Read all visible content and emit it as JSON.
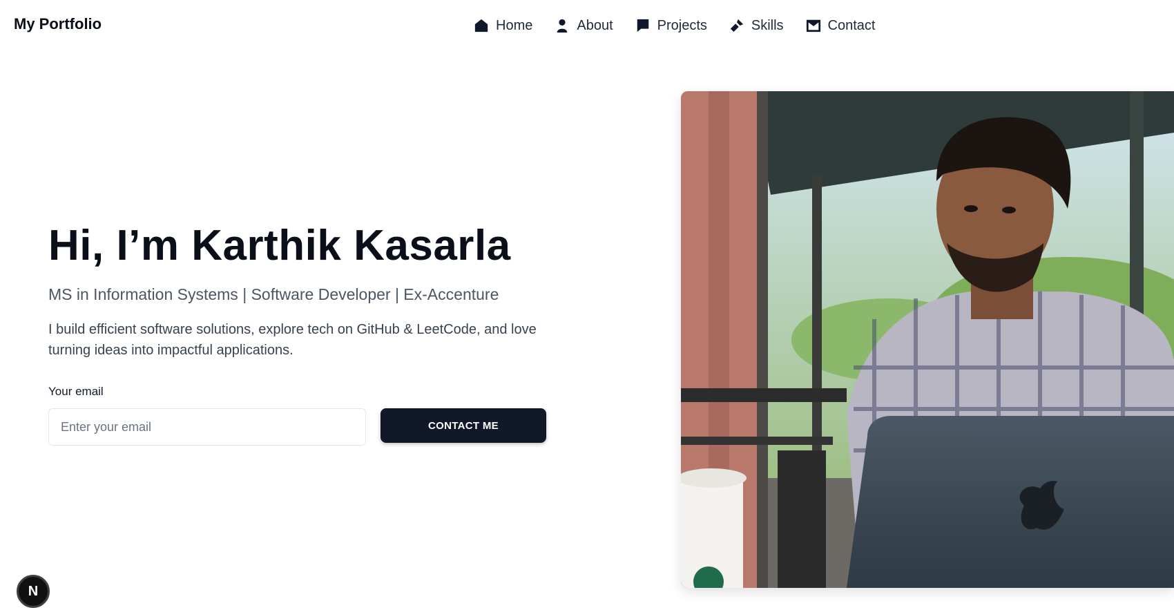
{
  "header": {
    "logo": "My Portfolio",
    "nav": [
      {
        "label": "Home",
        "icon": "home-icon"
      },
      {
        "label": "About",
        "icon": "user-icon"
      },
      {
        "label": "Projects",
        "icon": "chat-bubble-icon"
      },
      {
        "label": "Skills",
        "icon": "tools-icon"
      },
      {
        "label": "Contact",
        "icon": "envelope-icon"
      }
    ]
  },
  "hero": {
    "title": "Hi, I’m Karthik Kasarla",
    "subtitle": "MS in Information Systems | Software Developer | Ex-Accenture",
    "description": "I build efficient software solutions, explore tech on GitHub & LeetCode, and love turning ideas into impactful applications.",
    "email_label": "Your email",
    "email_placeholder": "Enter your email",
    "email_value": "",
    "cta_label": "CONTACT ME"
  },
  "dev_badge": {
    "label": "N"
  },
  "colors": {
    "primary": "#111827",
    "text_muted": "#4b5563",
    "background": "#ffffff"
  }
}
